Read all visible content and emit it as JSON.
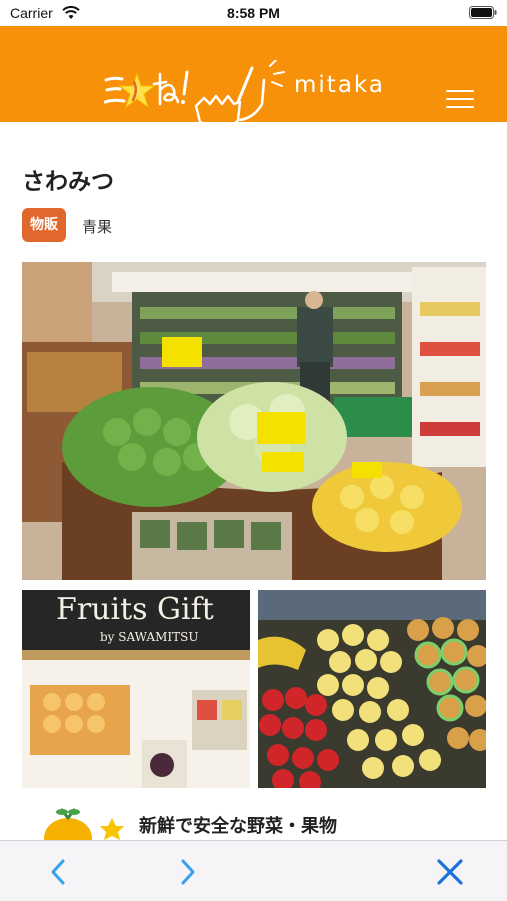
{
  "status_bar": {
    "carrier": "Carrier",
    "time": "8:58 PM"
  },
  "header": {
    "logo_alt": "mitaka",
    "logo_text": "mitaka",
    "background": "#f8910a"
  },
  "shop": {
    "name": "さわみつ",
    "tag": "物販",
    "category": "青果"
  },
  "photos": {
    "main": "produce store interior",
    "fruits_gift_sign": "Fruits Gift",
    "fruits_gift_sub": "by SAWAMITSU",
    "left": "fruits gift display",
    "right": "apples and pears display"
  },
  "content": {
    "headline": "新鮮で安全な野菜・果物"
  },
  "toolbar": {
    "back_icon": "chevron-left-icon",
    "forward_icon": "chevron-right-icon",
    "close_icon": "close-icon"
  },
  "colors": {
    "accent": "#f8910a",
    "tag": "#e0672e",
    "toolbar_icons": "#3a9fea",
    "close": "#1a73d9"
  }
}
